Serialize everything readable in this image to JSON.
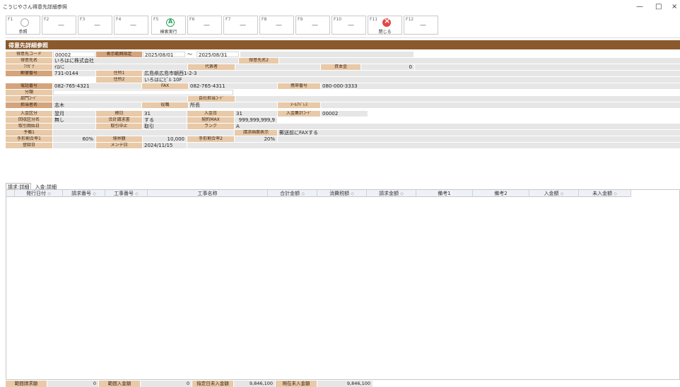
{
  "window": {
    "title": "こうじやさん得意先詳細参照",
    "minimize": "—",
    "maximize": "□",
    "close": "×"
  },
  "fkeys": [
    {
      "num": "F1",
      "label": "参照"
    },
    {
      "num": "F2",
      "label": ""
    },
    {
      "num": "F3",
      "label": ""
    },
    {
      "num": "F4",
      "label": ""
    },
    {
      "num": "F5",
      "label": "検索実行"
    },
    {
      "num": "F6",
      "label": ""
    },
    {
      "num": "F7",
      "label": ""
    },
    {
      "num": "F8",
      "label": ""
    },
    {
      "num": "F9",
      "label": ""
    },
    {
      "num": "F10",
      "label": ""
    },
    {
      "num": "F11",
      "label": "閉じる"
    },
    {
      "num": "F12",
      "label": ""
    }
  ],
  "section_title": "得意先詳細参照",
  "form": {
    "customer_code_label": "得意先コード",
    "customer_code": "00002",
    "range_label": "表示範囲指定",
    "range_from": "2025/08/01",
    "range_tilde": "～",
    "range_to": "2025/08/31",
    "name_label": "得意先名",
    "name": "いろはに株式会社",
    "name2_label": "得意先名2",
    "name2": "",
    "kana_label": "ﾌﾘｶﾞﾅ",
    "kana": "ｲﾛﾊﾆ",
    "rep_label": "代表者",
    "rep": "",
    "capital_label": "資本金",
    "capital": "0",
    "zip_label": "郵便番号",
    "zip": "731-0144",
    "addr1_label": "住所1",
    "addr1": "広島県広島市朝西1-2-3",
    "addr2_label": "住所2",
    "addr2": "いろはにﾋﾞﾙ 10F",
    "tel_label": "電話番号",
    "tel": "082-765-4321",
    "fax_label": "FAX",
    "fax": "082-765-4311",
    "mobile_label": "携帯番号",
    "mobile": "080-000-3333",
    "class_label": "分類",
    "class": "",
    "dept_label": "部門ｺｰﾄﾞ",
    "dept": "",
    "inhouse_label": "自社担当ｺｰﾄﾞ",
    "inhouse": "",
    "person_label": "担当者名",
    "person": "志木",
    "title_label": "役職",
    "title": "所長",
    "mail_label": "ﾒｰﾙｱﾄﾞﾚｽ",
    "mail": "",
    "pay_label": "入金区分",
    "pay": "翌月",
    "close_label": "締日",
    "close": "31",
    "payday_label": "入金日",
    "payday": "31",
    "sumcode_label": "入金集計ｺｰﾄﾞ",
    "sumcode": "00002",
    "collect_label": "回収区分名",
    "collect": "無し",
    "total_inv_label": "合計請求書",
    "total_inv": "する",
    "limit_label": "契約MAX",
    "limit": "999,999,999,9",
    "stopdate_label": "取引開始日",
    "stopdate": "",
    "stop_label": "取引中止",
    "stop": "取引",
    "rank_label": "ランク",
    "rank": "A",
    "spare1_label": "予備1",
    "spare1": "",
    "inv_disp_label": "請求画面表示",
    "inv_disp": "郵送前にFAXする",
    "rate1_label": "手形割合率1",
    "rate1": "60%",
    "border_label": "境界額",
    "border": "10,000",
    "rate2_label": "手形割合率2",
    "rate2": "20%",
    "regdate_label": "登録日",
    "regdate": "",
    "maint_label": "メンテ日",
    "maint": "2024/11/15"
  },
  "tabs": [
    "請求:詳細",
    "入金:詳細"
  ],
  "grid_columns": [
    "発行日付",
    "請求番号",
    "工事番号",
    "工事名称",
    "合計金額",
    "消費税額",
    "請求金額",
    "備考1",
    "備考2",
    "入金額",
    "未入金額"
  ],
  "sort_icon": "◇",
  "footer": {
    "range_inv_label": "範囲請求額",
    "range_inv": "0",
    "range_pay_label": "範囲入金額",
    "range_pay": "0",
    "unpaid_label": "指定日未入金額",
    "unpaid": "9,846,100",
    "cur_unpaid_label": "現在未入金額",
    "cur_unpaid": "9,846,100"
  }
}
